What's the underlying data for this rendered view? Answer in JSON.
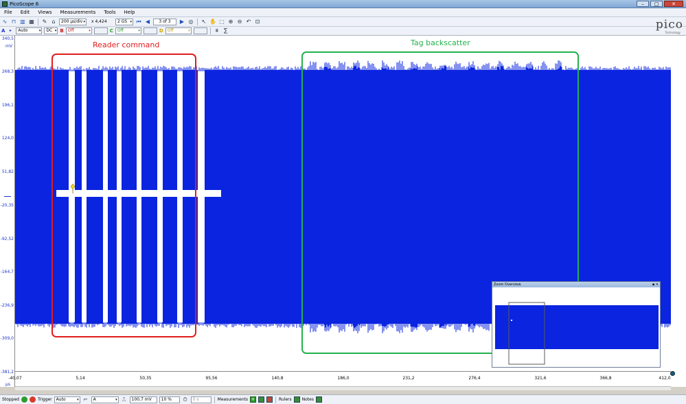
{
  "window": {
    "title": "PicoScope 6",
    "controls": [
      "–",
      "□",
      "✕"
    ]
  },
  "menu": [
    "File",
    "Edit",
    "Views",
    "Measurements",
    "Tools",
    "Help"
  ],
  "toolbar1": {
    "timebase": "200 µs/div",
    "zoom": "x 4,424",
    "samples": "2 GS",
    "buffer": "3 of 3"
  },
  "toolbar2": {
    "channel_a": {
      "letter": "A",
      "range": "Auto",
      "coupling": "DC"
    },
    "channel_b": {
      "letter": "B",
      "range": "Off"
    },
    "channel_c": {
      "letter": "C",
      "range": "Off"
    },
    "channel_d": {
      "letter": "D",
      "range": "Off"
    }
  },
  "logo": {
    "brand": "pico",
    "sub": "Technology"
  },
  "yaxis": {
    "unit": "mV",
    "ticks": [
      "340,5",
      "268,3",
      "196,1",
      "124,0",
      "51,82",
      "-20,35",
      "-92,52",
      "-164,7",
      "-236,9",
      "-309,0",
      "-381,2"
    ]
  },
  "xaxis": {
    "unit": "µs",
    "ticks": [
      "-40,07",
      "5,14",
      "50,35",
      "95,56",
      "140,8",
      "186,0",
      "231,2",
      "276,4",
      "321,6",
      "366,8",
      "412,0"
    ]
  },
  "annotations": {
    "reader": "Reader command",
    "tag": "Tag backscatter"
  },
  "zoom_overview": {
    "title": "Zoom Overview"
  },
  "statusbar": {
    "state": "Stopped",
    "trigger_label": "Trigger",
    "trigger_mode": "Auto",
    "trigger_channel": "A",
    "threshold": "100,7 mV",
    "pretrigger": "10 %",
    "delay": "0 s",
    "measurements": "Measurements",
    "rulers": "Rulers",
    "notes": "Notes"
  },
  "colors": {
    "signal": "#0b24e0",
    "reader_box": "#e21c1c",
    "tag_box": "#22b14c"
  }
}
